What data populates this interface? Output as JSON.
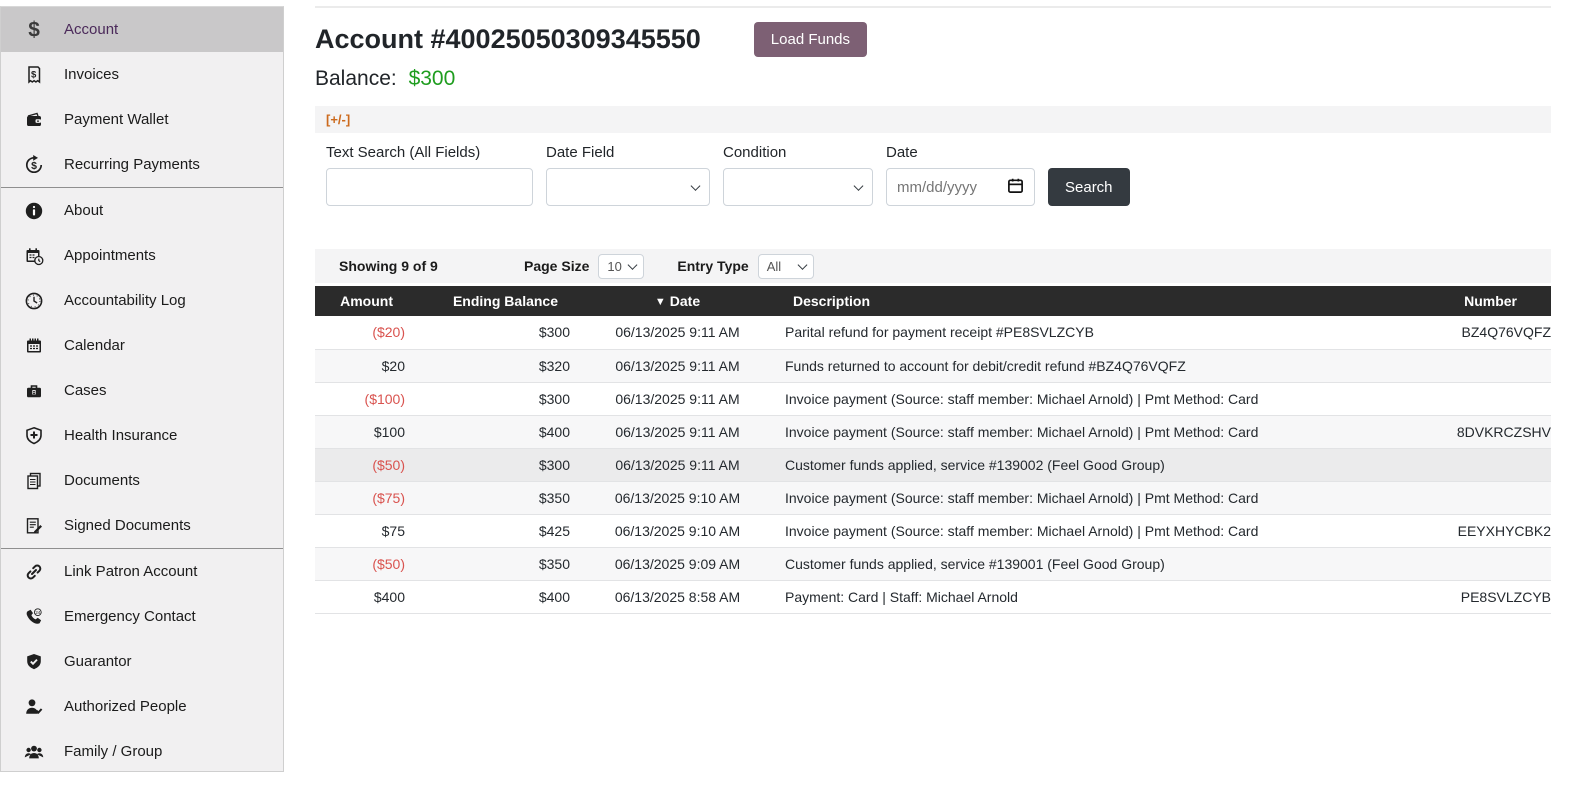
{
  "sidebar": {
    "items": [
      {
        "label": "Account",
        "icon": "dollar",
        "selected": true
      },
      {
        "label": "Invoices",
        "icon": "receipt"
      },
      {
        "label": "Payment Wallet",
        "icon": "wallet"
      },
      {
        "label": "Recurring Payments",
        "icon": "recurring-dollar",
        "divider_after": true
      },
      {
        "label": "About",
        "icon": "info"
      },
      {
        "label": "Appointments",
        "icon": "appointment-calendar"
      },
      {
        "label": "Accountability Log",
        "icon": "clock"
      },
      {
        "label": "Calendar",
        "icon": "calendar"
      },
      {
        "label": "Cases",
        "icon": "briefcase"
      },
      {
        "label": "Health Insurance",
        "icon": "shield-cross"
      },
      {
        "label": "Documents",
        "icon": "documents"
      },
      {
        "label": "Signed Documents",
        "icon": "signed-document",
        "divider_after": true
      },
      {
        "label": "Link Patron Account",
        "icon": "link"
      },
      {
        "label": "Emergency Contact",
        "icon": "phone-24"
      },
      {
        "label": "Guarantor",
        "icon": "shield-check"
      },
      {
        "label": "Authorized People",
        "icon": "person-check"
      },
      {
        "label": "Family / Group",
        "icon": "people-group"
      }
    ]
  },
  "header": {
    "title": "Account #40025050309345550",
    "load_funds_label": "Load Funds",
    "balance_label": "Balance:",
    "balance_value": "$300"
  },
  "filters": {
    "toggle_label": "[+/-]",
    "text_search_label": "Text Search (All Fields)",
    "date_field_label": "Date Field",
    "condition_label": "Condition",
    "date_label": "Date",
    "date_placeholder": "mm/dd/yyyy",
    "search_button_label": "Search"
  },
  "table_controls": {
    "showing_text": "Showing 9 of 9",
    "page_size_label": "Page Size",
    "page_size_value": "10",
    "entry_type_label": "Entry Type",
    "entry_type_value": "All"
  },
  "table": {
    "columns": [
      "Amount",
      "Ending Balance",
      "Date",
      "Description",
      "Number"
    ],
    "sort_indicator": "▼",
    "rows": [
      {
        "amount": "($20)",
        "negative": true,
        "ending_balance": "$300",
        "date": "06/13/2025 9:11 AM",
        "description": "Parital refund for payment receipt #PE8SVLZCYB",
        "number": "BZ4Q76VQFZ"
      },
      {
        "amount": "$20",
        "negative": false,
        "ending_balance": "$320",
        "date": "06/13/2025 9:11 AM",
        "description": "Funds returned to account for debit/credit refund #BZ4Q76VQFZ",
        "number": ""
      },
      {
        "amount": "($100)",
        "negative": true,
        "ending_balance": "$300",
        "date": "06/13/2025 9:11 AM",
        "description": "Invoice payment (Source: staff member: Michael Arnold) | Pmt Method: Card",
        "number": ""
      },
      {
        "amount": "$100",
        "negative": false,
        "ending_balance": "$400",
        "date": "06/13/2025 9:11 AM",
        "description": "Invoice payment (Source: staff member: Michael Arnold) | Pmt Method: Card",
        "number": "8DVKRCZSHV"
      },
      {
        "amount": "($50)",
        "negative": true,
        "ending_balance": "$300",
        "date": "06/13/2025 9:11 AM",
        "description": "Customer funds applied, service #139002 (Feel Good Group)",
        "number": "",
        "highlighted": true
      },
      {
        "amount": "($75)",
        "negative": true,
        "ending_balance": "$350",
        "date": "06/13/2025 9:10 AM",
        "description": "Invoice payment (Source: staff member: Michael Arnold) | Pmt Method: Card",
        "number": ""
      },
      {
        "amount": "$75",
        "negative": false,
        "ending_balance": "$425",
        "date": "06/13/2025 9:10 AM",
        "description": "Invoice payment (Source: staff member: Michael Arnold) | Pmt Method: Card",
        "number": "EEYXHYCBK2"
      },
      {
        "amount": "($50)",
        "negative": true,
        "ending_balance": "$350",
        "date": "06/13/2025 9:09 AM",
        "description": "Customer funds applied, service #139001 (Feel Good Group)",
        "number": ""
      },
      {
        "amount": "$400",
        "negative": false,
        "ending_balance": "$400",
        "date": "06/13/2025 8:58 AM",
        "description": "Payment: Card | Staff: Michael Arnold",
        "number": "PE8SVLZCYB"
      }
    ]
  },
  "colors": {
    "accent_button": "#7d6074",
    "balance_green": "#1f9d1f",
    "negative_red": "#d9534f",
    "table_header_dark": "#2b2b2b",
    "toggle_orange": "#cc6a1d",
    "sidebar_selected_text": "#4b2a5a",
    "sidebar_selected_bg": "#c9c8c9"
  }
}
